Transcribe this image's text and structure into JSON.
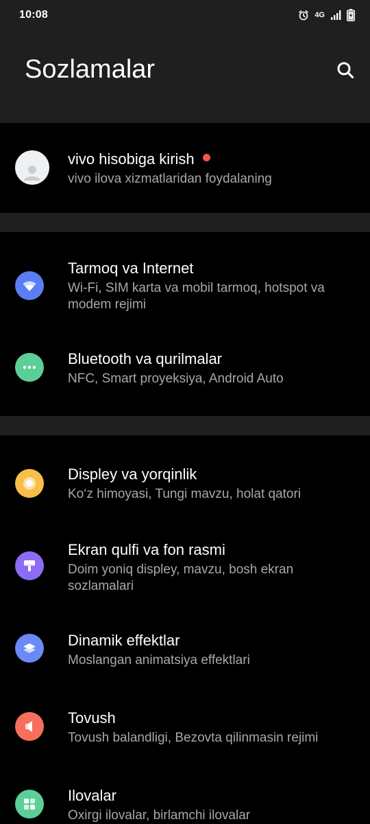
{
  "status_bar": {
    "time": "10:08",
    "network": "4G",
    "icons": [
      "alarm-icon",
      "signal-icon",
      "battery-charging-icon"
    ]
  },
  "header": {
    "title": "Sozlamalar",
    "search_icon": "search-icon"
  },
  "account": {
    "title": "vivo hisobiga kirish",
    "subtitle": "vivo ilova xizmatlaridan foydalaning",
    "has_notification_dot": true
  },
  "settings_groups": [
    {
      "items": [
        {
          "title": "Tarmoq va Internet",
          "subtitle": "Wi-Fi, SIM karta va mobil tarmoq, hotspot va modem rejimi",
          "icon": "wifi-icon",
          "color": "#5b7ff2"
        },
        {
          "title": "Bluetooth va qurilmalar",
          "subtitle": "NFC, Smart proyeksiya, Android Auto",
          "icon": "more-dots-icon",
          "color": "#5ccf97"
        }
      ]
    },
    {
      "items": [
        {
          "title": "Displey va yorqinlik",
          "subtitle": "Ko‘z himoyasi, Tungi mavzu, holat qatori",
          "icon": "brightness-icon",
          "color": "#f7be4a"
        },
        {
          "title": "Ekran qulfi va fon rasmi",
          "subtitle": "Doim yoniq displey, mavzu, bosh ekran sozlamalari",
          "icon": "paint-roller-icon",
          "color": "#8b6cf2"
        },
        {
          "title": "Dinamik effektlar",
          "subtitle": "Moslangan animatsiya effektlari",
          "icon": "layers-icon",
          "color": "#6b8af5"
        },
        {
          "title": "Tovush",
          "subtitle": "Tovush balandligi, Bezovta qilinmasin rejimi",
          "icon": "speaker-icon",
          "color": "#f56f5c"
        },
        {
          "title": "Ilovalar",
          "subtitle": "Oxirgi ilovalar, birlamchi ilovalar",
          "icon": "apps-grid-icon",
          "color": "#5ccf97"
        }
      ]
    }
  ]
}
